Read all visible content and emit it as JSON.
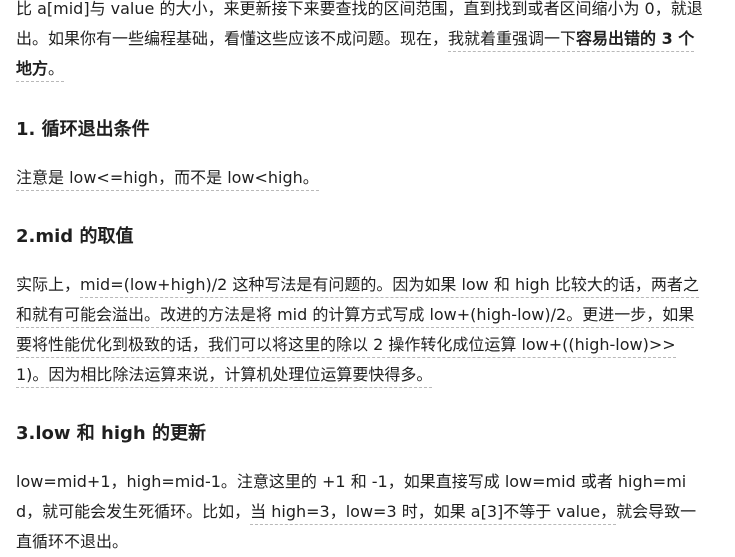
{
  "intro": {
    "t1": "比 a[mid]与 value 的大小，来更新接下来要查找的区间范围，直到找到或者区间缩小为 0，就退出。如果你有一些编程基础，看懂这些应该不成问题。现在，",
    "u1": "我就着重强调一下",
    "b1": "容易出错的 3 个地方",
    "u2": "。"
  },
  "section1": {
    "heading": "1. 循环退出条件",
    "u1": "注意是 low<=high，而不是 low<high。"
  },
  "section2": {
    "heading": "2.mid 的取值",
    "t1": "实际上，",
    "u1": "mid=(low+high)/2 这种写法是有问题的。因为如果 low 和 high 比较大的话，两者之和就有可能会溢出。改进的方法是将 mid 的计算方式写成 low+(high-low)/2。更进一步，如果要将性能优化到极致的话，我们可以将这里的除以 2 操作转化成位运算 low+((high-low)>>1)。因为相比除法运算来说，计算机处理位运算要快得多。"
  },
  "section3": {
    "heading": "3.low 和 high 的更新",
    "t1": "low=mid+1，high=mid-1。注意这里的 +1 和 -1，如果直接写成 low=mid 或者 high=mid，就可能会发生死循环。比如，",
    "u1": "当 high=3，low=3 时，如果 a[3]不等于 value，",
    "t2": "就会导致一直循环不退出。"
  }
}
